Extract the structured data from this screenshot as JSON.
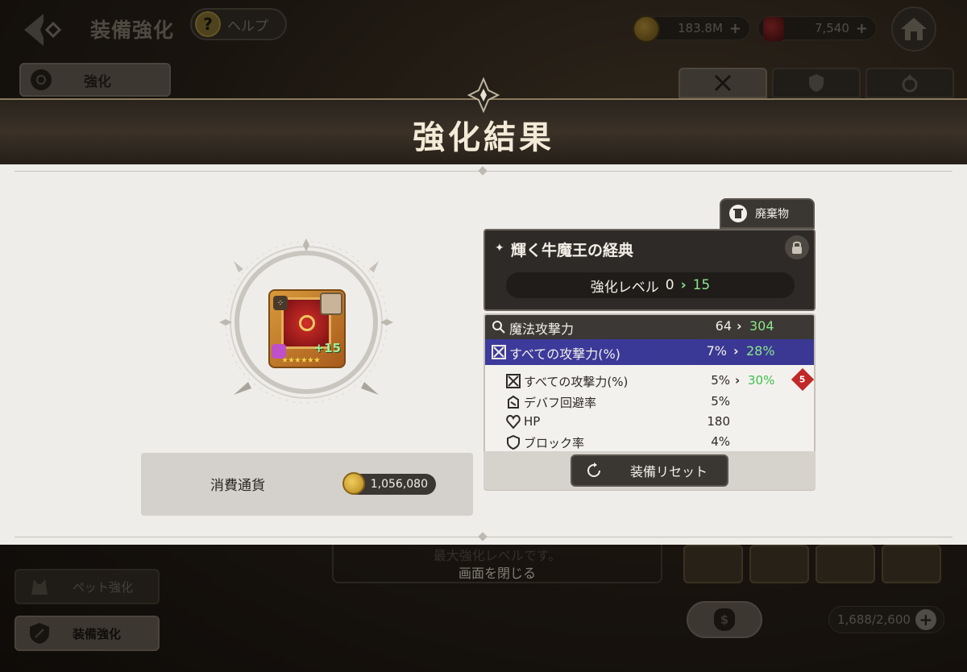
{
  "header": {
    "screen_title": "装備強化",
    "help_label": "ヘルプ",
    "help_icon_glyph": "?",
    "gold_amount": "183.8M",
    "gem_amount": "7,540"
  },
  "tabs": {
    "enhance_label": "強化"
  },
  "side_menu": {
    "pet_label": "ペット強化",
    "equipment_label": "装備強化"
  },
  "background": {
    "max_level_text": "最大強化レベルです。",
    "close_text": "画面を閉じる",
    "capacity": "1,688/2,600",
    "bag_glyph": "$"
  },
  "result": {
    "title": "強化結果",
    "trash_label": "廃棄物",
    "item_name": "輝く牛魔王の経典",
    "item_plus": "+15",
    "item_stars": "★★★★★★",
    "level_label": "強化レベル",
    "level_from": "0",
    "level_to": "15",
    "cost_label": "消費通貨",
    "cost_amount": "1,056,080",
    "reset_label": "装備リセット",
    "stats": {
      "main": {
        "name": "魔法攻撃力",
        "from": "64",
        "to": "304"
      },
      "highlight": {
        "name": "すべての攻撃力(%)",
        "from": "7%",
        "to": "28%"
      },
      "sub": [
        {
          "name": "すべての攻撃力(%)",
          "from": "5%",
          "to": "30%",
          "badge": "5"
        },
        {
          "name": "デバフ回避率",
          "value": "5%"
        },
        {
          "name": "HP",
          "value": "180"
        },
        {
          "name": "ブロック率",
          "value": "4%"
        }
      ]
    }
  },
  "colors": {
    "panel_bg": "#efedea",
    "highlight_bg": "#3c3a9c",
    "increase_green": "#8ee58a",
    "badge_red": "#c02828"
  }
}
